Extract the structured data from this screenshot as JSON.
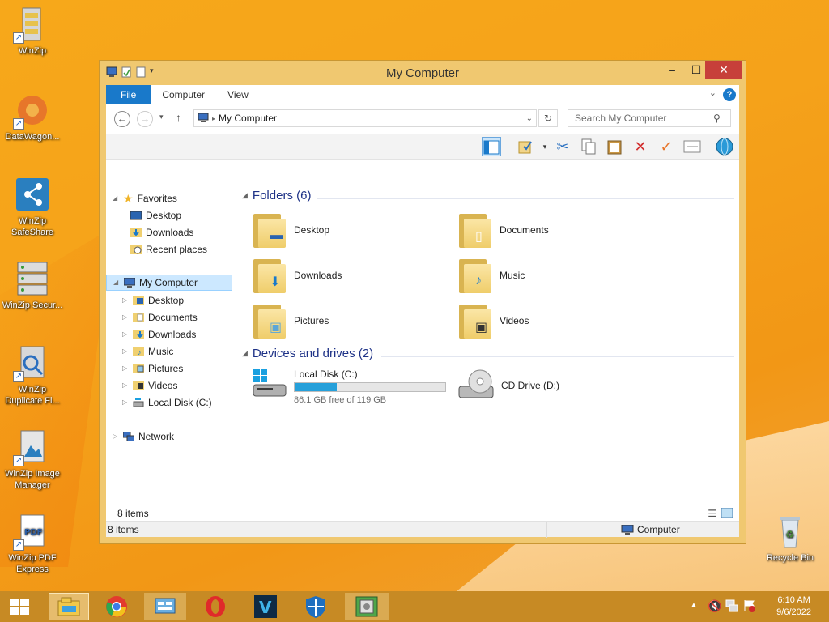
{
  "desktop": {
    "icons": [
      {
        "label": "WinZip"
      },
      {
        "label": "DataWagon..."
      },
      {
        "label": "WinZip SafeShare"
      },
      {
        "label": "WinZip Secur..."
      },
      {
        "label": "WinZip Duplicate Fi..."
      },
      {
        "label": "WinZip Image Manager"
      },
      {
        "label": "WinZip PDF Express"
      },
      {
        "label": "Recycle Bin"
      }
    ]
  },
  "window": {
    "title": "My Computer",
    "controls": {
      "minimize": "–",
      "maximize": "☐",
      "close": "✕"
    },
    "tabs": [
      {
        "label": "File"
      },
      {
        "label": "Computer"
      },
      {
        "label": "View"
      }
    ],
    "address": {
      "path": "My Computer"
    },
    "search": {
      "placeholder": "Search My Computer"
    },
    "navpane": {
      "favorites": "Favorites",
      "favorites_items": [
        "Desktop",
        "Downloads",
        "Recent places"
      ],
      "computer": "My Computer",
      "computer_items": [
        "Desktop",
        "Documents",
        "Downloads",
        "Music",
        "Pictures",
        "Videos",
        "Local Disk (C:)"
      ],
      "network": "Network"
    },
    "folders_header": "Folders (6)",
    "folders": [
      {
        "name": "Desktop"
      },
      {
        "name": "Documents"
      },
      {
        "name": "Downloads"
      },
      {
        "name": "Music"
      },
      {
        "name": "Pictures"
      },
      {
        "name": "Videos"
      }
    ],
    "devices_header": "Devices and drives (2)",
    "drives": [
      {
        "name": "Local Disk (C:)",
        "free": "86.1 GB free of 119 GB",
        "used_fraction": 0.28
      },
      {
        "name": "CD Drive (D:)"
      }
    ],
    "item_count": "8 items",
    "status": {
      "left": "8 items",
      "right": "Computer"
    }
  },
  "taskbar": {
    "time": "6:10 AM",
    "date": "9/6/2022"
  },
  "colors": {
    "accent": "#1979ca",
    "progress": "#26a0da",
    "window_frame": "#f0c870",
    "taskbar": "#c78a24"
  }
}
